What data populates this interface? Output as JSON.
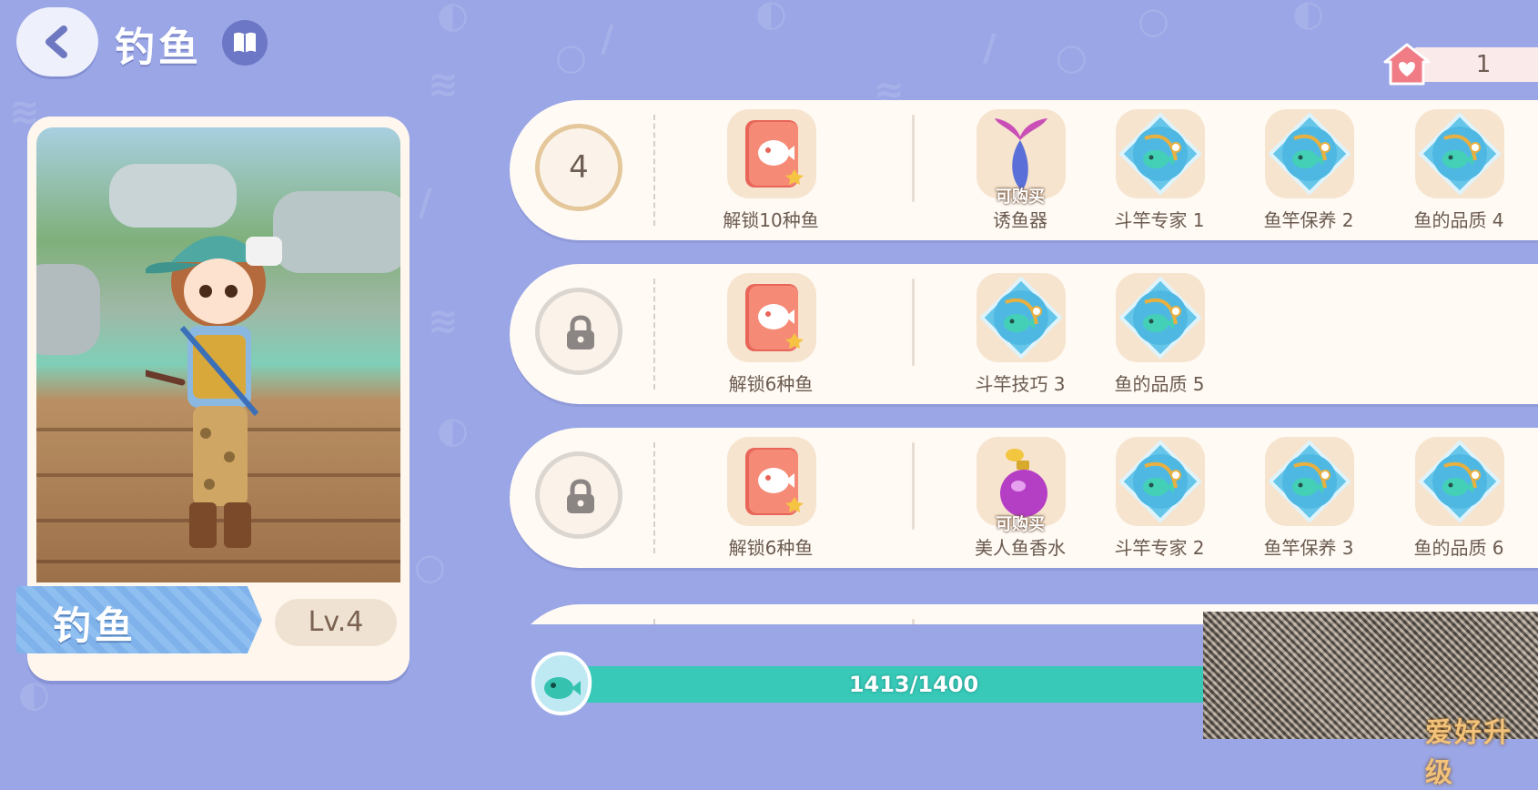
{
  "header": {
    "title": "钓鱼"
  },
  "counter": {
    "value": "1"
  },
  "character": {
    "name": "钓鱼",
    "level": "Lv.4"
  },
  "rows": [
    {
      "level": "4",
      "locked": false,
      "unlock_label": "解锁10种鱼",
      "rewards": [
        {
          "label": "诱鱼器",
          "icon": "mermaid-tail-lure-icon",
          "buy": "可购买"
        },
        {
          "label": "斗竿专家 1",
          "icon": "fish-rod-badge-icon"
        },
        {
          "label": "鱼竿保养 2",
          "icon": "fish-rod-badge-icon"
        },
        {
          "label": "鱼的品质 4",
          "icon": "fish-rod-badge-icon"
        }
      ]
    },
    {
      "level": "",
      "locked": true,
      "unlock_label": "解锁6种鱼",
      "rewards": [
        {
          "label": "斗竿技巧 3",
          "icon": "fish-rod-badge-icon"
        },
        {
          "label": "鱼的品质 5",
          "icon": "fish-rod-badge-icon"
        }
      ]
    },
    {
      "level": "",
      "locked": true,
      "unlock_label": "解锁6种鱼",
      "rewards": [
        {
          "label": "美人鱼香水",
          "icon": "perfume-bottle-icon",
          "buy": "可购买"
        },
        {
          "label": "斗竿专家 2",
          "icon": "fish-rod-badge-icon"
        },
        {
          "label": "鱼竿保养 3",
          "icon": "fish-rod-badge-icon"
        },
        {
          "label": "鱼的品质 6",
          "icon": "fish-rod-badge-icon"
        }
      ]
    }
  ],
  "progress": {
    "text": "1413/1400",
    "fraction": 0.72
  },
  "watermark": {
    "text": "爱好升级"
  },
  "colors": {
    "accent": "#38c9b8",
    "background": "#9aa6e6",
    "tile": "#f6e4cf",
    "card": "#fffaf4"
  }
}
